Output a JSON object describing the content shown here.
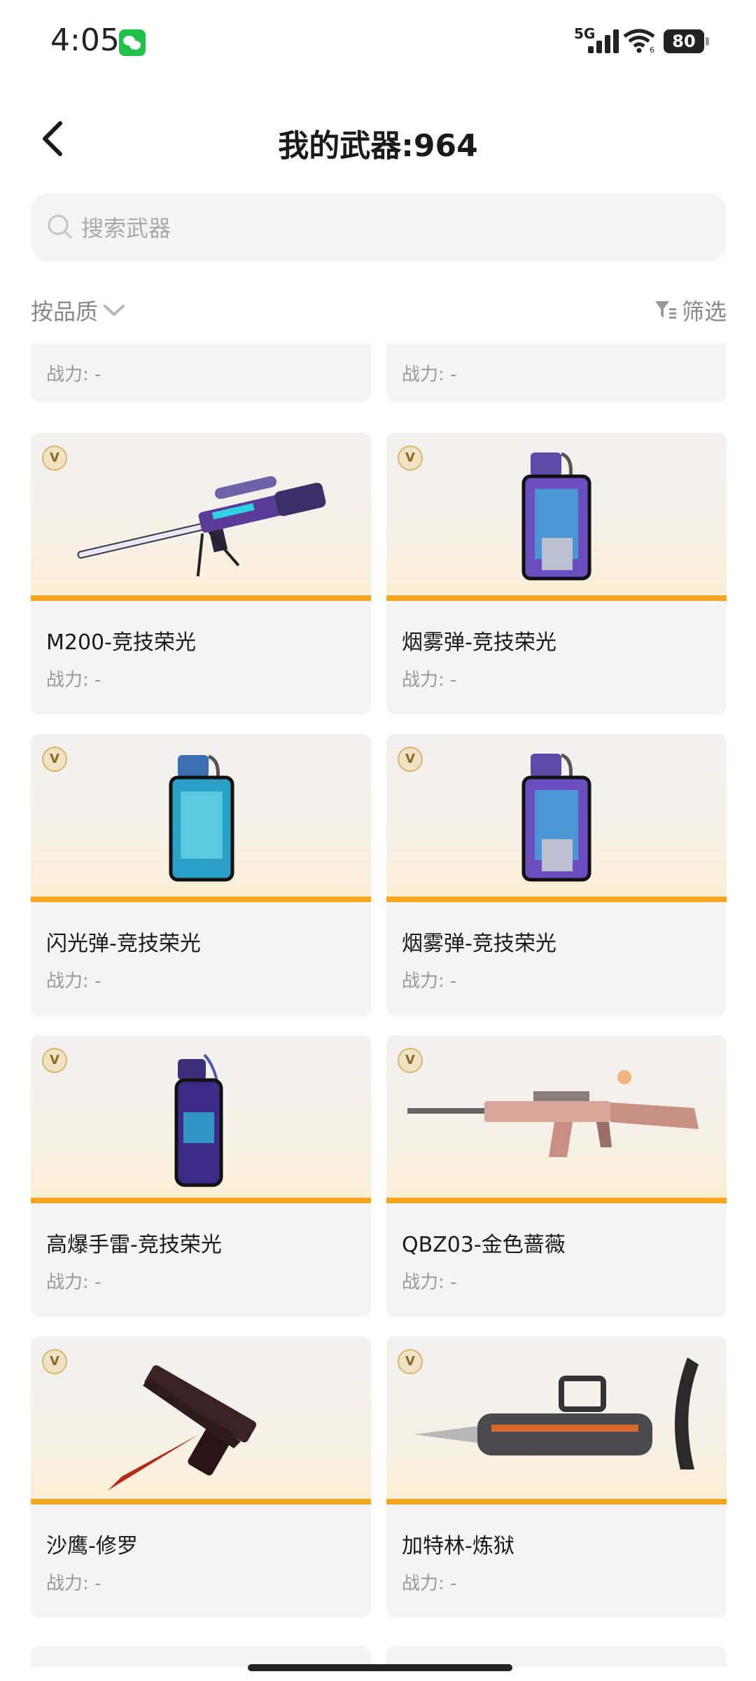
{
  "status_bar": {
    "time": "4:05",
    "network": "5G",
    "wifi_sub": "6",
    "battery": "80"
  },
  "header": {
    "title": "我的武器:964"
  },
  "search": {
    "placeholder": "搜索武器"
  },
  "filters": {
    "sort_label": "按品质",
    "filter_label": "筛选"
  },
  "top_partial": [
    {
      "power": "战力: -"
    },
    {
      "power": "战力: -"
    }
  ],
  "weapons": [
    {
      "name": "M200-竞技荣光",
      "power": "战力: -",
      "badge": "V",
      "icon": "sniper-rifle-icon"
    },
    {
      "name": "烟雾弹-竞技荣光",
      "power": "战力: -",
      "badge": "V",
      "icon": "grenade-canister-icon"
    },
    {
      "name": "闪光弹-竞技荣光",
      "power": "战力: -",
      "badge": "V",
      "icon": "grenade-canister-icon"
    },
    {
      "name": "烟雾弹-竞技荣光",
      "power": "战力: -",
      "badge": "V",
      "icon": "grenade-canister-icon"
    },
    {
      "name": "高爆手雷-竞技荣光",
      "power": "战力: -",
      "badge": "V",
      "icon": "grenade-canister-icon"
    },
    {
      "name": "QBZ03-金色蔷薇",
      "power": "战力: -",
      "badge": "V",
      "icon": "assault-rifle-icon"
    },
    {
      "name": "沙鹰-修罗",
      "power": "战力: -",
      "badge": "V",
      "icon": "pistol-knife-icon"
    },
    {
      "name": "加特林-炼狱",
      "power": "战力: -",
      "badge": "V",
      "icon": "gatling-gun-icon"
    }
  ],
  "colors": {
    "accent_bar": "#f5a51f",
    "card_bg": "#f4f4f4",
    "badge_gold": "#d7b56a"
  }
}
